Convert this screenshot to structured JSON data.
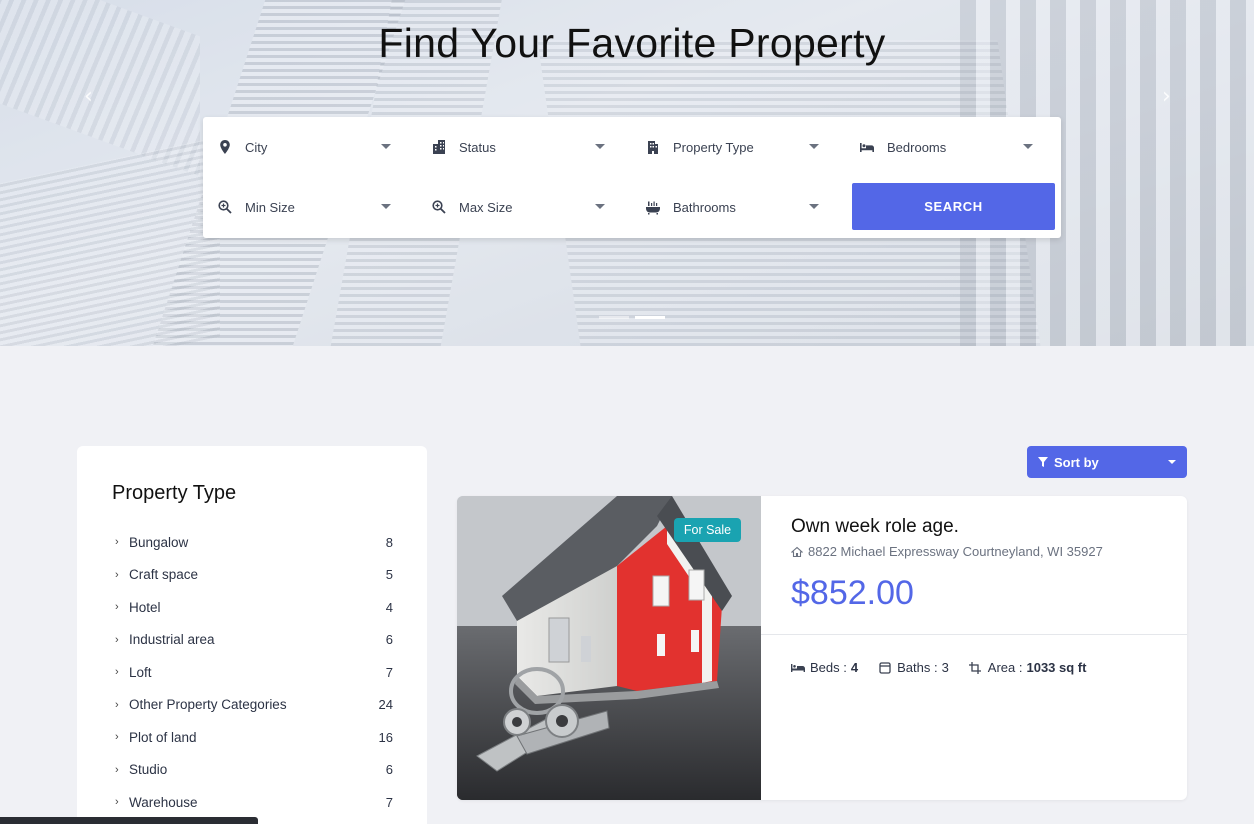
{
  "hero": {
    "title": "Find Your Favorite Property",
    "prev_arrow": "‹",
    "next_arrow": "›"
  },
  "search": {
    "fields": [
      {
        "label": "City",
        "icon": "location-pin-icon"
      },
      {
        "label": "Status",
        "icon": "building-icon"
      },
      {
        "label": "Property Type",
        "icon": "office-building-icon"
      },
      {
        "label": "Bedrooms",
        "icon": "bed-icon"
      },
      {
        "label": "Min Size",
        "icon": "zoom-in-icon"
      },
      {
        "label": "Max Size",
        "icon": "zoom-in-icon"
      },
      {
        "label": "Bathrooms",
        "icon": "bathtub-icon"
      }
    ],
    "button_label": "SEARCH"
  },
  "sidebar": {
    "title": "Property Type",
    "items": [
      {
        "label": "Bungalow",
        "count": "8"
      },
      {
        "label": "Craft space",
        "count": "5"
      },
      {
        "label": "Hotel",
        "count": "4"
      },
      {
        "label": "Industrial area",
        "count": "6"
      },
      {
        "label": "Loft",
        "count": "7"
      },
      {
        "label": "Other Property Categories",
        "count": "24"
      },
      {
        "label": "Plot of land",
        "count": "16"
      },
      {
        "label": "Studio",
        "count": "6"
      },
      {
        "label": "Warehouse",
        "count": "7"
      }
    ]
  },
  "sort": {
    "label": "Sort by"
  },
  "listing": {
    "badge": "For Sale",
    "title": "Own week role age.",
    "address": "8822 Michael Expressway Courtneyland, WI 35927",
    "price": "$852.00",
    "beds_label": "Beds :",
    "beds_value": "4",
    "baths_label": "Baths :",
    "baths_value": "3",
    "area_label": "Area :",
    "area_value": "1033 sq ft"
  },
  "colors": {
    "accent": "#5367e7",
    "badge": "#1aa3b1"
  },
  "slider": {
    "active_slide": 2,
    "total_slides": 2
  }
}
